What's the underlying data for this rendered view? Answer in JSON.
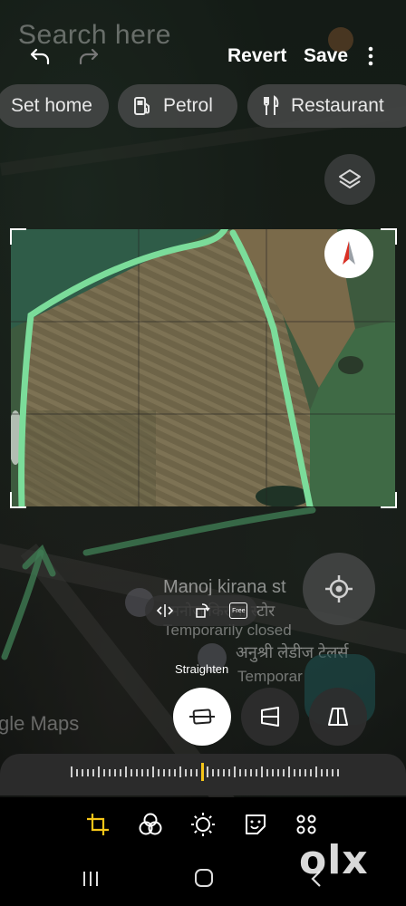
{
  "map": {
    "search_placeholder": "Search here",
    "chips": [
      {
        "label": "Set home",
        "icon": "home-icon"
      },
      {
        "label": "Petrol",
        "icon": "fuel-pump-icon"
      },
      {
        "label": "Restaurant",
        "icon": "fork-knife-icon"
      }
    ],
    "place_name": "Manoj kirana st",
    "place_name_hindi": "मनोज किराना स्टोर",
    "place_status": "Temporarily closed",
    "place2_name_hindi": "अनुश्री लेडीज टेलर्स",
    "place2_status": "Temporar",
    "watermark": "gle Maps"
  },
  "editor": {
    "revert_label": "Revert",
    "save_label": "Save",
    "straighten_label": "Straighten",
    "free_label": "Free",
    "accent_color": "#f5c518",
    "path_color": "#7bdc9a",
    "angle_value": 0
  },
  "brand": {
    "logo": "olx"
  }
}
